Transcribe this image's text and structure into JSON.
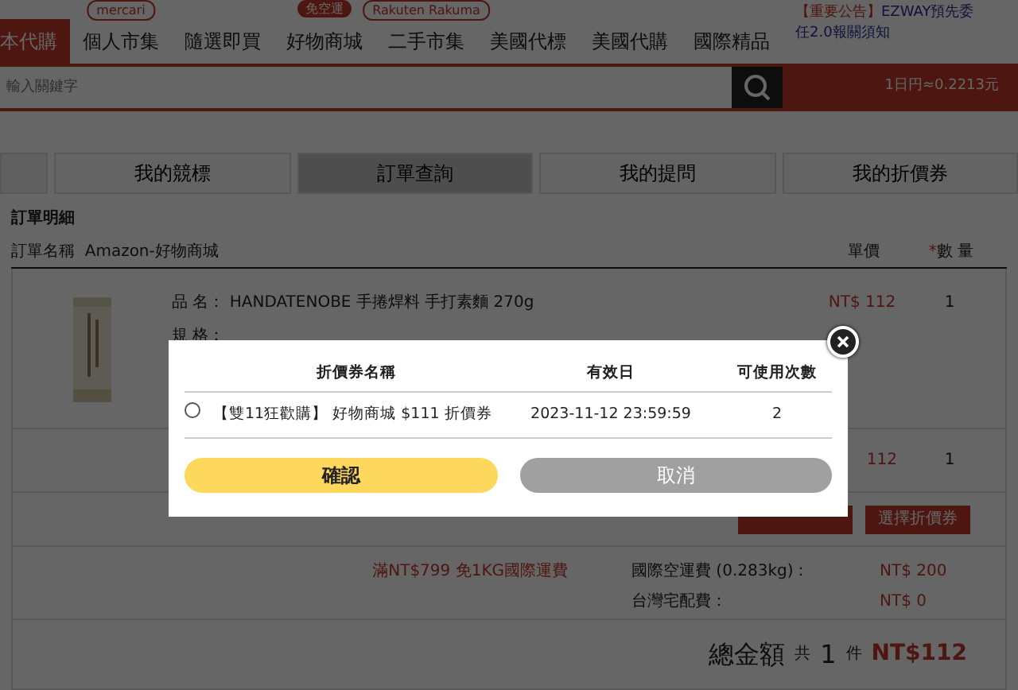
{
  "nav": {
    "items": [
      {
        "label": "本代購",
        "selected": true
      },
      {
        "label": "個人市集",
        "selected": false,
        "tag": {
          "text": "mercari",
          "kind": "outline"
        }
      },
      {
        "label": "隨選即買",
        "selected": false
      },
      {
        "label": "好物商城",
        "selected": false,
        "tag": {
          "text": "免空運",
          "kind": "filled"
        }
      },
      {
        "label": "二手市集",
        "selected": false,
        "tag": {
          "text": "Rakuten Rakuma",
          "kind": "outline"
        }
      },
      {
        "label": "美國代標",
        "selected": false
      },
      {
        "label": "美國代購",
        "selected": false
      },
      {
        "label": "國際精品",
        "selected": false
      }
    ],
    "notice": {
      "prefix": "【重要公告】",
      "text": "EZWAY預先委任2.0報關須知"
    }
  },
  "search": {
    "placeholder": "輸入關鍵字",
    "rate": "1日円≈0.2213元"
  },
  "tabs": [
    {
      "label": "我的競標",
      "selected": false
    },
    {
      "label": "訂單查詢",
      "selected": true
    },
    {
      "label": "我的提問",
      "selected": false
    },
    {
      "label": "我的折價券",
      "selected": false
    }
  ],
  "order": {
    "title": "訂單明細",
    "name_label": "訂單名稱",
    "name": "Amazon-好物商城",
    "columns": {
      "price": "單價",
      "qty_mark": "*",
      "qty": "數 量"
    },
    "item": {
      "name_label": "品 名：",
      "name": "HANDATENOBE 手捲焊料 手打素麵 270g",
      "spec_label": "規 格：",
      "price": "NT$ 112",
      "qty": "1"
    },
    "subtotal": {
      "price": "112",
      "qty": "1"
    },
    "coupon_button": "選擇折價券",
    "shipping": {
      "promo": "滿NT$799 免1KG國際運費",
      "fees": [
        {
          "label": "國際空運費 (0.283kg)：",
          "value": "NT$ 200"
        },
        {
          "label": "台灣宅配費：",
          "value": "NT$ 0"
        }
      ]
    },
    "total": {
      "label": "總金額",
      "count_prefix": "共",
      "count": "1",
      "count_suffix": "件",
      "amount": "NT$112"
    }
  },
  "modal": {
    "columns": [
      "折價券名稱",
      "有效日",
      "可使用次數"
    ],
    "rows": [
      {
        "selected": false,
        "name": "【雙11狂歡購】 好物商城 $111 折價券",
        "expires": "2023-11-12 23:59:59",
        "uses": "2"
      }
    ],
    "confirm": "確認",
    "cancel": "取消"
  }
}
